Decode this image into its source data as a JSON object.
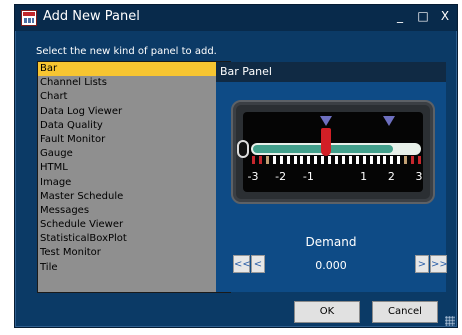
{
  "window": {
    "title": "Add New Panel",
    "controls": {
      "minimize": "_",
      "maximize": "□",
      "close": "X"
    }
  },
  "prompt": "Select the new kind of panel to add.",
  "panel_types": [
    "Bar",
    "Channel Lists",
    "Chart",
    "Data Log Viewer",
    "Data Quality",
    "Fault Monitor",
    "Gauge",
    "HTML",
    "Image",
    "Master Schedule",
    "Messages",
    "Schedule Viewer",
    "StatisticalBoxPlot",
    "Test Monitor",
    "Tile"
  ],
  "selected_index": 0,
  "preview": {
    "header": "Bar Panel",
    "gauge": {
      "scale_labels": [
        "-3",
        "-2",
        "-1",
        "1",
        "2",
        "3"
      ],
      "scale_min": -3,
      "scale_max": 3,
      "needle_value": -0.35,
      "marker_values": [
        -0.35,
        1.9
      ],
      "colors": {
        "bar_fill": "#43a08c",
        "needle": "#d21f26",
        "marker": "#6d6fbf"
      }
    },
    "channel_label": "Demand",
    "value": "0.000",
    "buttons": {
      "fast_back": "<<",
      "back": "<",
      "forward": ">",
      "fast_forward": ">>"
    }
  },
  "buttons": {
    "ok": "OK",
    "cancel": "Cancel"
  },
  "colors": {
    "window_bg": "#0b3a66",
    "selection": "#f7c531",
    "preview_bg": "#0e4b86"
  }
}
